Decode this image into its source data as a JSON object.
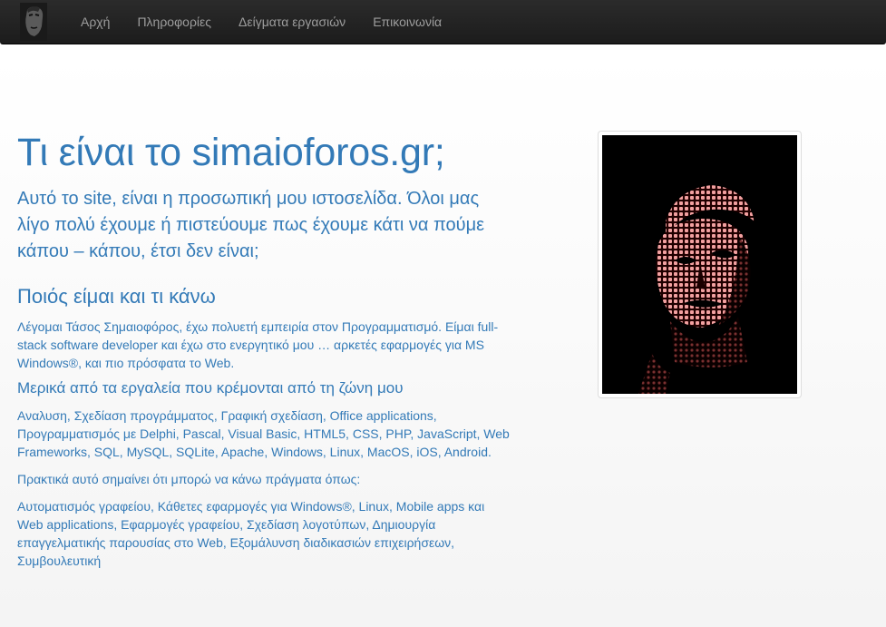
{
  "nav": {
    "items": [
      {
        "label": "Αρχή"
      },
      {
        "label": "Πληροφορίες"
      },
      {
        "label": "Δείγματα εργασιών"
      },
      {
        "label": "Επικοινωνία"
      }
    ]
  },
  "hero": {
    "title": "Τι είναι το simaioforos.gr;",
    "lead": "Αυτό το site, είναι η προσωπική μου ιστοσελίδα. Όλοι μας λίγο πολύ έχουμε ή πιστεύουμε πως έχουμε κάτι να πούμε κάπου – κάπου, έτσι δεν είναι;"
  },
  "about": {
    "heading": "Ποιός είμαι και τι κάνω",
    "text": "Λέγομαι Τάσος Σημαιοφόρος, έχω πολυετή εμπειρία στον Προγραμματισμό. Είμαι full-stack software developer και έχω στο ενεργητικό μου … αρκετές εφαρμογές για MS Windows®, και πιο πρόσφατα το Web."
  },
  "tools": {
    "heading": "Μερικά από τα εργαλεία που κρέμονται από τη ζώνη μου",
    "text": "Αναλυση, Σχεδίαση προγράμματος, Γραφική σχεδίαση, Office applications, Προγραμματισμός με Delphi, Pascal, Visual Basic, HTML5, CSS, PHP, JavaScript, Web Frameworks, SQL, MySQL, SQLite, Apache, Windows, Linux, MacOS, iOS, Android.",
    "practical_intro": "Πρακτικά αυτό σημαίνει ότι μπορώ να κάνω πράγματα όπως:",
    "practical_list": "Αυτοματισμός γραφείου, Κάθετες εφαρμογές για Windows®, Linux, Mobile apps και Web applications, Εφαρμογές γραφείου, Σχεδίαση λογοτύπων, Δημιουργία επαγγελματικής παρουσίας στο Web, Εξομάλυνση διαδικασιών επιχειρήσεων, Συμβουλευτική"
  },
  "colors": {
    "navbar": "#222222",
    "nav_text": "#9d9d9d",
    "accent": "#337ab7",
    "portrait_dots": "#f08080"
  }
}
